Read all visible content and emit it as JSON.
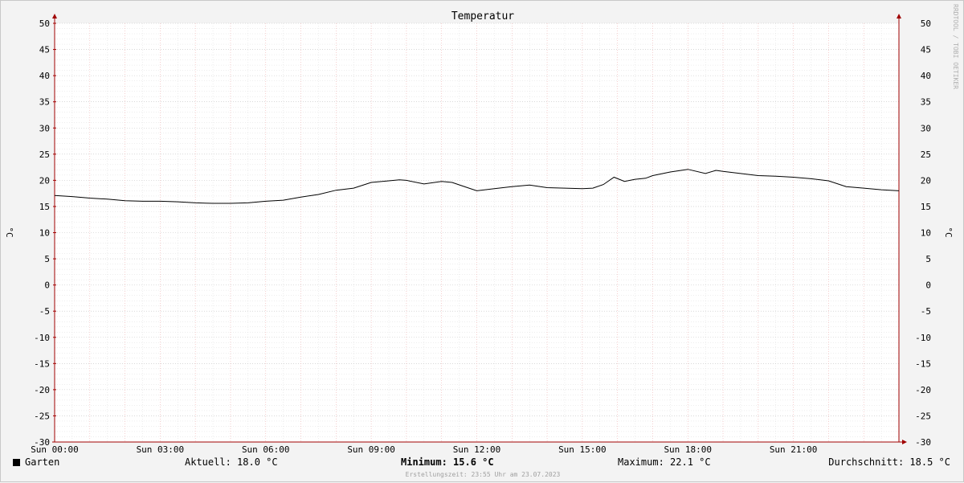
{
  "chart_data": {
    "type": "line",
    "title": "Temperatur",
    "ylabel": "°C",
    "ylabel_right": "°C",
    "ylim": [
      -30,
      50
    ],
    "yticks": [
      50,
      45,
      40,
      35,
      30,
      25,
      20,
      15,
      10,
      5,
      0,
      -5,
      -10,
      -15,
      -20,
      -25,
      -30
    ],
    "x_range_hours": [
      0,
      24
    ],
    "xticks": [
      {
        "hour": 0,
        "label": "Sun 00:00"
      },
      {
        "hour": 3,
        "label": "Sun 03:00"
      },
      {
        "hour": 6,
        "label": "Sun 06:00"
      },
      {
        "hour": 9,
        "label": "Sun 09:00"
      },
      {
        "hour": 12,
        "label": "Sun 12:00"
      },
      {
        "hour": 15,
        "label": "Sun 15:00"
      },
      {
        "hour": 18,
        "label": "Sun 18:00"
      },
      {
        "hour": 21,
        "label": "Sun 21:00"
      }
    ],
    "grid": true,
    "series": [
      {
        "name": "Garten",
        "color": "#000000",
        "x_hours": [
          0,
          0.5,
          1,
          1.5,
          2,
          2.5,
          3,
          3.5,
          4,
          4.5,
          5,
          5.5,
          6,
          6.5,
          7,
          7.5,
          8,
          8.5,
          9,
          9.5,
          9.8,
          10,
          10.5,
          11,
          11.3,
          11.6,
          12,
          12.5,
          13,
          13.5,
          14,
          14.5,
          15,
          15.3,
          15.6,
          15.9,
          16.2,
          16.5,
          16.8,
          17,
          17.5,
          18,
          18.5,
          18.8,
          19,
          19.5,
          20,
          20.5,
          21,
          21.5,
          22,
          22.5,
          23,
          23.5,
          24
        ],
        "values": [
          17.1,
          16.9,
          16.6,
          16.4,
          16.1,
          16.0,
          16.0,
          15.9,
          15.7,
          15.6,
          15.6,
          15.7,
          16.0,
          16.2,
          16.8,
          17.3,
          18.1,
          18.5,
          19.6,
          19.9,
          20.1,
          20.0,
          19.3,
          19.8,
          19.6,
          18.9,
          18.0,
          18.4,
          18.8,
          19.1,
          18.6,
          18.5,
          18.4,
          18.5,
          19.2,
          20.6,
          19.8,
          20.2,
          20.4,
          20.9,
          21.6,
          22.1,
          21.3,
          21.9,
          21.7,
          21.3,
          20.9,
          20.8,
          20.6,
          20.3,
          19.9,
          18.8,
          18.5,
          18.2,
          18.0
        ]
      }
    ],
    "legend": [
      {
        "label": "Garten",
        "color": "#000000"
      }
    ],
    "stats": {
      "current_label": "Aktuell:",
      "current_value": "18.0 °C",
      "min_label": "Minimum:",
      "min_value": "15.6 °C",
      "max_label": "Maximum:",
      "max_value": "22.1 °C",
      "avg_label": "Durchschnitt:",
      "avg_value": "18.5 °C"
    },
    "created": "Erstellungszeit: 23:55 Uhr am 23.07.2023",
    "watermark": "RRDTOOL / TOBI OETIKER"
  }
}
